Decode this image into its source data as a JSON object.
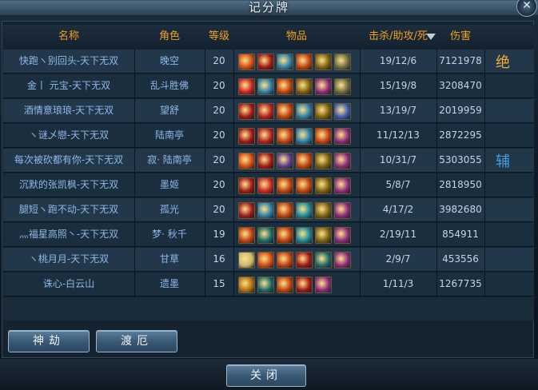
{
  "window": {
    "title": "记分牌",
    "close_icon": "close-x-icon"
  },
  "columns": {
    "name": "名称",
    "role": "角色",
    "level": "等级",
    "items": "物品",
    "kda": "击杀/助攻/死",
    "damage": "伤害"
  },
  "rows": [
    {
      "name": "快跑ヽ别回头-天下无双",
      "role": "晚空",
      "level": "20",
      "kda": "19/12/6",
      "damage": "7121978",
      "mark": "绝",
      "mark_color": "#f0b030",
      "items": [
        "#d14a14",
        "#a01818",
        "#2a7fa8",
        "#c04010",
        "#7a6010",
        "#6a6a40"
      ]
    },
    {
      "name": "金丨 元宝-天下无双",
      "role": "乱斗胜佛",
      "level": "20",
      "kda": "15/19/8",
      "damage": "3208470",
      "mark": "",
      "mark_color": "",
      "items": [
        "#c82424",
        "#2a7fa8",
        "#c04010",
        "#7a6010",
        "#8a2a7a",
        "#6a6a40"
      ]
    },
    {
      "name": "酒情意琅琅-天下无双",
      "role": "望舒",
      "level": "20",
      "kda": "13/19/7",
      "damage": "2019959",
      "mark": "",
      "mark_color": "",
      "items": [
        "#a01818",
        "#b02020",
        "#c04010",
        "#2a7fa8",
        "#7a6010",
        "#3a5ab0"
      ]
    },
    {
      "name": "ヽ谜乄戀-天下无双",
      "role": "陆南亭",
      "level": "20",
      "kda": "11/12/13",
      "damage": "2872295",
      "mark": "",
      "mark_color": "",
      "items": [
        "#a01818",
        "#b02020",
        "#c04010",
        "#2a7fa8",
        "#c04010",
        "#8a2a7a"
      ]
    },
    {
      "name": "每次被砍都有你-天下无双",
      "role": "寂· 陆南亭",
      "level": "20",
      "kda": "10/31/7",
      "damage": "5303055",
      "mark": "辅",
      "mark_color": "#4a9ae0",
      "items": [
        "#d14a14",
        "#a01818",
        "#5a3a8a",
        "#c04010",
        "#7a6010",
        "#8a2a7a"
      ]
    },
    {
      "name": "沉默的张凯枫-天下无双",
      "role": "墨姬",
      "level": "20",
      "kda": "5/8/7",
      "damage": "2818950",
      "mark": "",
      "mark_color": "",
      "items": [
        "#a01818",
        "#c82424",
        "#c04010",
        "#c04010",
        "#7a6010",
        "#8a2a7a"
      ]
    },
    {
      "name": "腿短ヽ跑不动-天下无双",
      "role": "孤光",
      "level": "20",
      "kda": "4/17/2",
      "damage": "3982680",
      "mark": "",
      "mark_color": "",
      "items": [
        "#a01818",
        "#2a7fa8",
        "#c04010",
        "#1a8a9a",
        "#7a6010",
        "#8a2a7a"
      ]
    },
    {
      "name": "灬福星高照丶-天下无双",
      "role": "梦· 秋千",
      "level": "19",
      "kda": "2/19/11",
      "damage": "854911",
      "mark": "",
      "mark_color": "",
      "items": [
        "#c04010",
        "#1a6a6a",
        "#c04010",
        "#1a8a9a",
        "#7a6010",
        "#8a2a7a"
      ]
    },
    {
      "name": "ヽ桃月月-天下无双",
      "role": "甘草",
      "level": "16",
      "kda": "2/9/7",
      "damage": "453556",
      "mark": "",
      "mark_color": "",
      "items": [
        "#c8b870",
        "#d14a14",
        "#c04010",
        "#a01818",
        "#1a6a6a",
        "#8a2a7a"
      ]
    },
    {
      "name": "诛心-白云山",
      "role": "遗墨",
      "level": "15",
      "kda": "1/11/3",
      "damage": "1267735",
      "mark": "",
      "mark_color": "",
      "items": [
        "#b07010",
        "#1a6a6a",
        "#c04010",
        "#a01818",
        "#8a2a7a"
      ]
    }
  ],
  "buttons": {
    "shenjie": "神劫",
    "du_e": "渡厄",
    "close": "关闭"
  },
  "colors": {
    "header_text": "#f0a020",
    "name_text": "#8fb8e8"
  }
}
